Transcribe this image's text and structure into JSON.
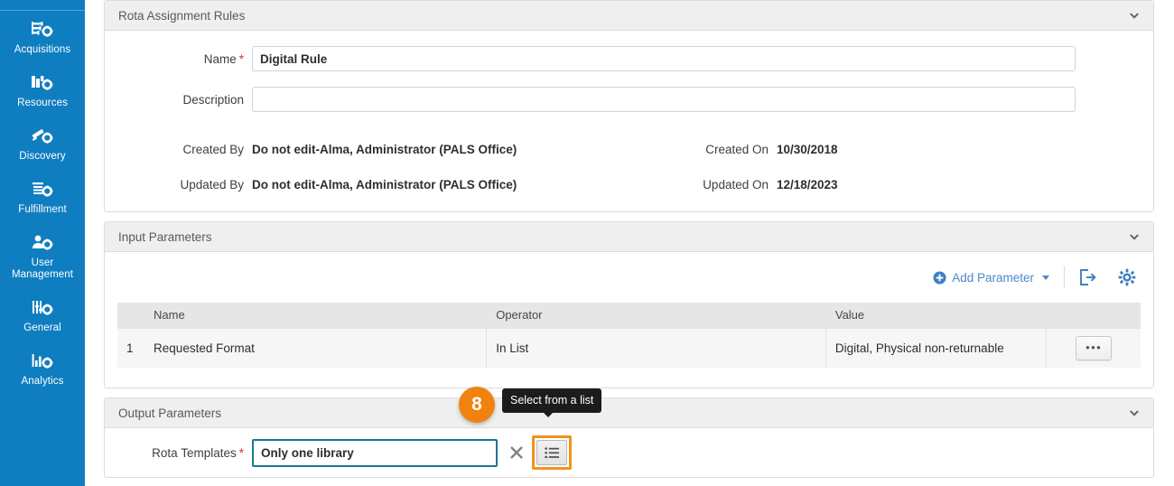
{
  "sidebar": {
    "items": [
      {
        "label": "Acquisitions",
        "icon": "acquisitions-icon"
      },
      {
        "label": "Resources",
        "icon": "resources-icon"
      },
      {
        "label": "Discovery",
        "icon": "discovery-icon"
      },
      {
        "label": "Fulfillment",
        "icon": "fulfillment-icon"
      },
      {
        "label": "User\nManagement",
        "label_line1": "User",
        "label_line2": "Management",
        "icon": "user-management-icon"
      },
      {
        "label": "General",
        "icon": "general-icon"
      },
      {
        "label": "Analytics",
        "icon": "analytics-icon"
      }
    ],
    "accent_color": "#0f7ec0"
  },
  "rules_card": {
    "title": "Rota Assignment Rules",
    "collapse_icon": "chevron-down-icon",
    "name_label": "Name",
    "name_required": "*",
    "name_value": "Digital Rule",
    "name_placeholder": "",
    "description_label": "Description",
    "description_value": "",
    "description_placeholder": "",
    "created_by_label": "Created By",
    "created_by_value": "Do not edit-Alma, Administrator (PALS Office)",
    "created_on_label": "Created On",
    "created_on_value": "10/30/2018",
    "updated_by_label": "Updated By",
    "updated_by_value": "Do not edit-Alma, Administrator (PALS Office)",
    "updated_on_label": "Updated On",
    "updated_on_value": "12/18/2023"
  },
  "input_params_card": {
    "title": "Input Parameters",
    "collapse_icon": "chevron-down-icon",
    "add_parameter_label": "Add Parameter",
    "add_icon": "plus-circle-icon",
    "dropdown_caret": "caret-down-icon",
    "export_icon": "export-icon",
    "settings_icon": "gear-icon",
    "link_color": "#4a89c8",
    "columns": [
      "",
      "Name",
      "Operator",
      "Value",
      ""
    ],
    "rows": [
      {
        "index": "1",
        "name": "Requested Format",
        "operator": "In List",
        "value": "Digital, Physical non-returnable",
        "actions_label": "•••"
      }
    ]
  },
  "output_params_card": {
    "title": "Output Parameters",
    "collapse_icon": "chevron-down-icon",
    "rota_templates_label": "Rota Templates",
    "rota_templates_required": "*",
    "rota_templates_value": "Only one library",
    "rota_templates_placeholder": "",
    "clear_icon": "close-x-icon",
    "select_list_icon": "list-icon",
    "tooltip_text": "Select from a list",
    "highlight_color": "#f4921e",
    "focus_border_color": "#1b7694"
  },
  "callout": {
    "number": "8",
    "color": "#f0830f"
  }
}
